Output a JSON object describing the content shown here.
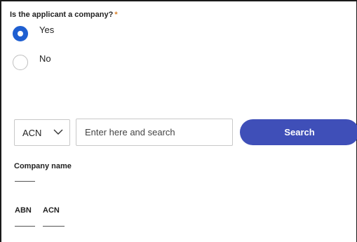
{
  "question": {
    "text": "Is the applicant a company?",
    "required_marker": "*"
  },
  "options": [
    {
      "label": "Yes",
      "selected": true
    },
    {
      "label": "No",
      "selected": false
    }
  ],
  "search": {
    "type_selected": "ACN",
    "placeholder": "Enter here and search",
    "value": "",
    "button_label": "Search"
  },
  "result": {
    "company_name_label": "Company name",
    "company_name_value": "",
    "abn_label": "ABN",
    "abn_value": "",
    "acn_label": "ACN",
    "acn_value": ""
  },
  "colors": {
    "accent": "#1f5fd1",
    "button": "#3f4fb8",
    "required": "#d9822b"
  },
  "icons": {
    "select_chevron": "chevron-down-icon"
  }
}
